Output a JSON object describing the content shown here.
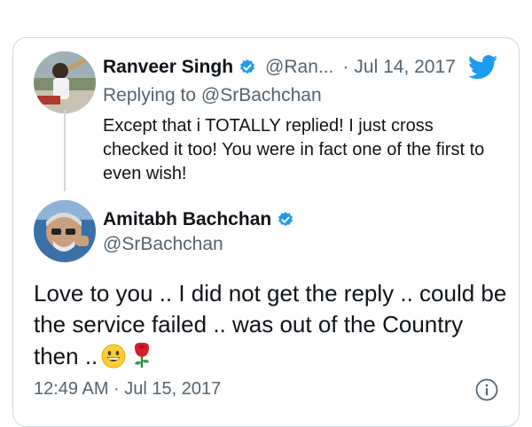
{
  "reply_tweet": {
    "display_name": "Ranveer Singh",
    "handle": "@Ran...",
    "separator": "·",
    "date": "Jul 14, 2017",
    "replying_prefix": "Replying to",
    "replying_handle": "@SrBachchan",
    "text": "Except that i TOTALLY replied! I just cross checked it too! You were in fact one of the first to even wish!"
  },
  "main_tweet": {
    "display_name": "Amitabh Bachchan",
    "handle": "@SrBachchan",
    "text": "Love to you .. I did not get the reply .. could be the service failed .. was out of the Country then ..",
    "timestamp": "12:49 AM · Jul 15, 2017"
  },
  "icons": {
    "verified": "verified-badge-icon",
    "twitter": "twitter-bird-icon",
    "info": "info-icon",
    "emoji_smile": "grinning-face-emoji",
    "emoji_rose": "rose-emoji"
  },
  "colors": {
    "verified_blue": "#1d9bf0",
    "secondary_text": "#536471",
    "border": "#cfd9de"
  }
}
